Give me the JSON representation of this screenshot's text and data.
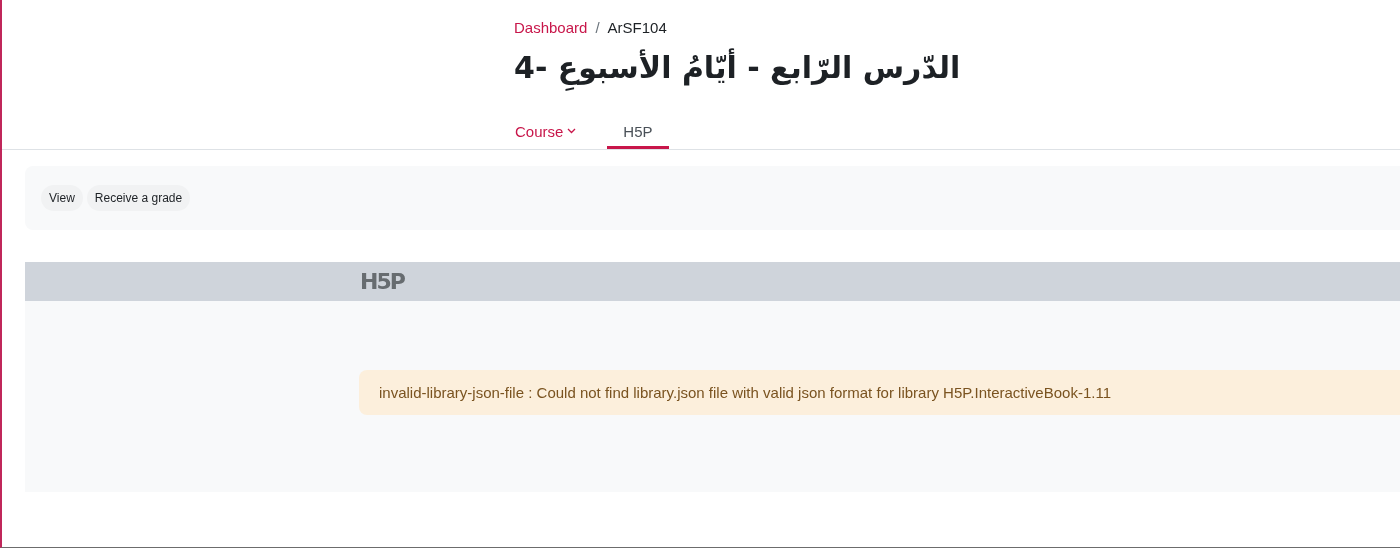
{
  "breadcrumb": [
    {
      "label": "Dashboard",
      "link": true
    },
    {
      "label": "ArSF104",
      "link": false
    }
  ],
  "breadcrumb_separator": "/",
  "title": "الدّرس الرّابع - أيّامُ الأسبوعِ -4",
  "tabs": [
    {
      "label": "Course",
      "dropdown": true,
      "selected": false
    },
    {
      "label": "H5P",
      "dropdown": false,
      "selected": true
    }
  ],
  "completion": [
    "View",
    "Receive a grade"
  ],
  "h5p": {
    "logo": "H5P",
    "message": "invalid-library-json-file : Could not find library.json file with valid json format for library H5P.InteractiveBook-1.11"
  }
}
